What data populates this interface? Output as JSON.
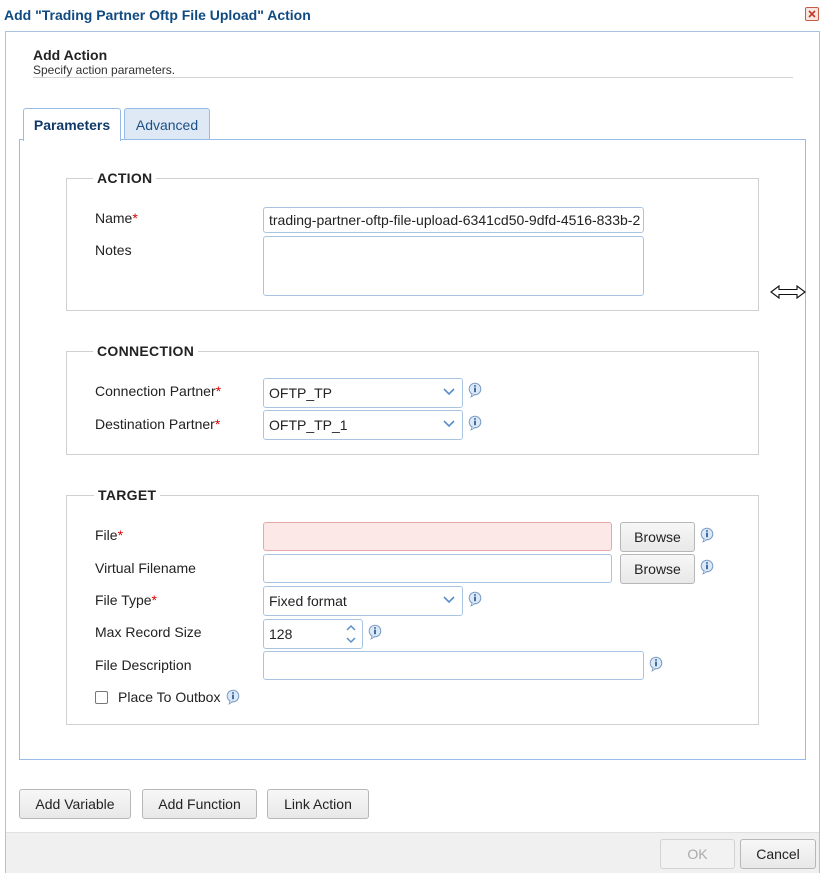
{
  "window": {
    "title": "Add \"Trading Partner Oftp File Upload\" Action",
    "close_icon": "close-icon"
  },
  "header": {
    "title": "Add Action",
    "subtitle": "Specify action parameters."
  },
  "tabs": [
    {
      "label": "Parameters",
      "active": true
    },
    {
      "label": "Advanced",
      "active": false
    }
  ],
  "action_section": {
    "legend": "ACTION",
    "name_label": "Name",
    "name_value": "trading-partner-oftp-file-upload-6341cd50-9dfd-4516-833b-2",
    "notes_label": "Notes",
    "notes_value": ""
  },
  "connection_section": {
    "legend": "CONNECTION",
    "connection_partner_label": "Connection Partner",
    "connection_partner_value": "OFTP_TP",
    "destination_partner_label": "Destination Partner",
    "destination_partner_value": "OFTP_TP_1"
  },
  "target_section": {
    "legend": "TARGET",
    "file_label": "File",
    "file_value": "",
    "virtual_filename_label": "Virtual Filename",
    "virtual_filename_value": "",
    "browse_label": "Browse",
    "file_type_label": "File Type",
    "file_type_value": "Fixed format",
    "max_record_size_label": "Max Record Size",
    "max_record_size_value": "128",
    "file_description_label": "File Description",
    "file_description_value": "",
    "place_to_outbox_label": "Place To Outbox",
    "place_to_outbox_checked": false
  },
  "required_marker": "*",
  "buttons": {
    "add_variable": "Add Variable",
    "add_function": "Add Function",
    "link_action": "Link Action",
    "ok": "OK",
    "cancel": "Cancel"
  },
  "colors": {
    "title": "#0f4a80",
    "border": "#99bbe8",
    "required": "#dd0000",
    "invalid_bg": "#fde8e8"
  }
}
